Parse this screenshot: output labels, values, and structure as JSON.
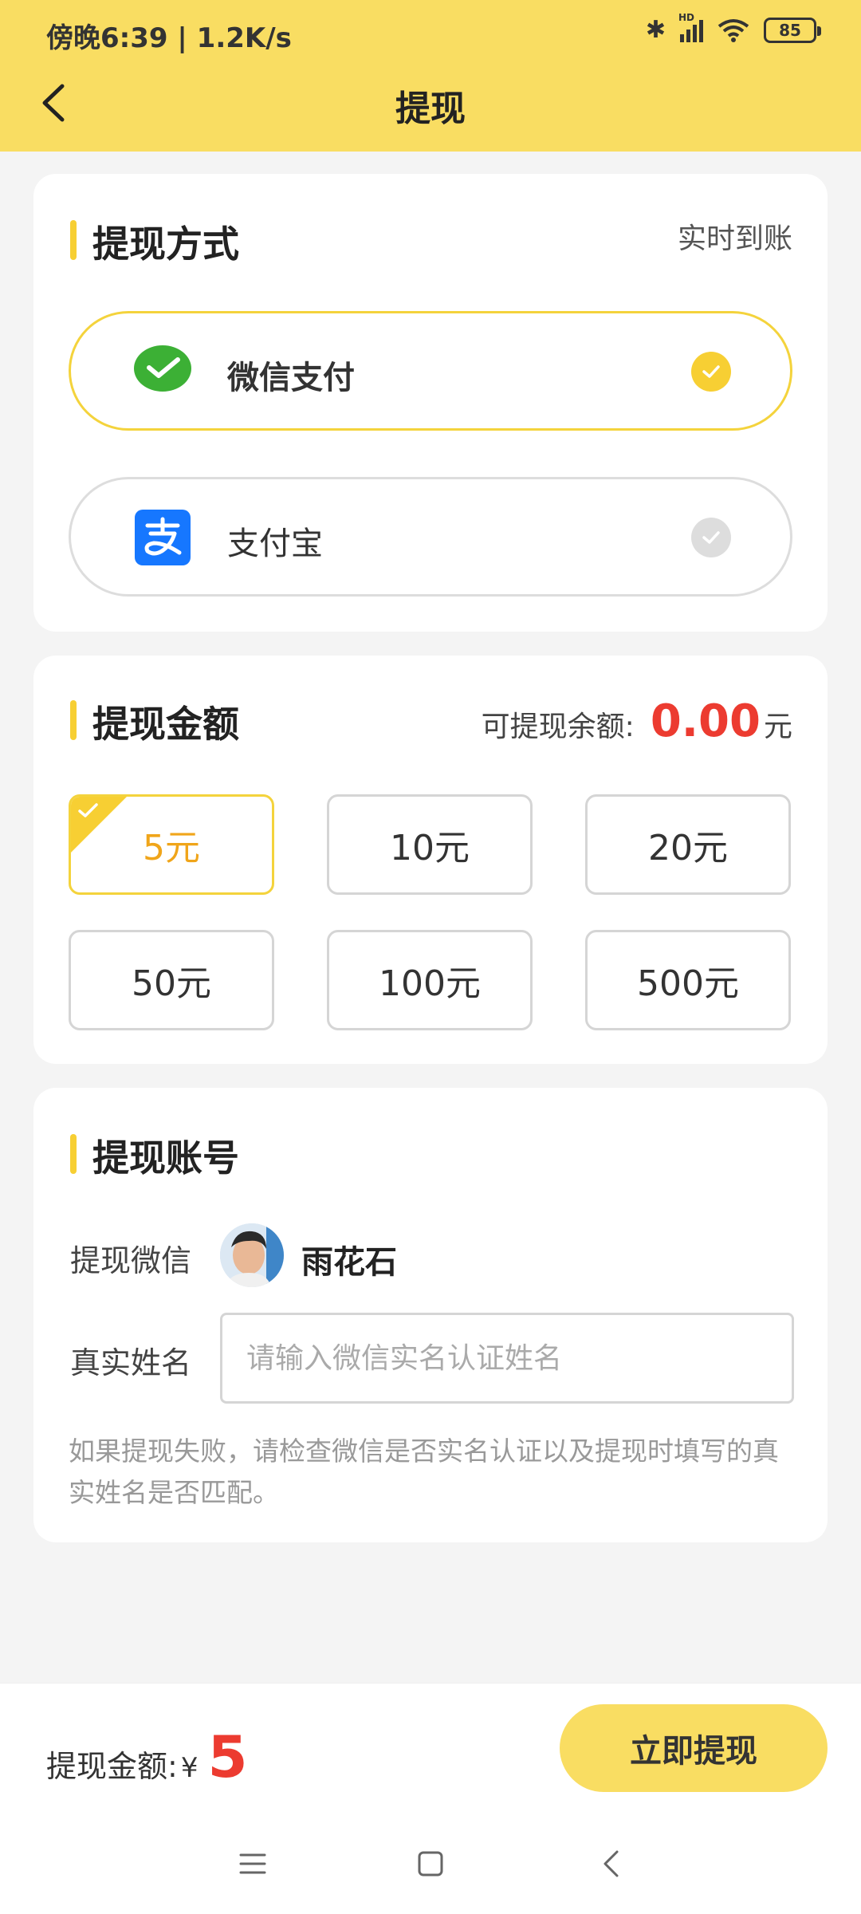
{
  "status_bar": {
    "time": "傍晚6:39 | 1.2K/s",
    "battery": "85",
    "network": "HD"
  },
  "header": {
    "title": "提现"
  },
  "method_section": {
    "title": "提现方式",
    "realtime_label": "实时到账",
    "options": [
      {
        "label": "微信支付",
        "icon": "wechat-icon",
        "selected": true
      },
      {
        "label": "支付宝",
        "icon": "alipay-icon",
        "selected": false
      }
    ]
  },
  "amount_section": {
    "title": "提现金额",
    "balance_label": "可提现余额:",
    "balance_value": "0.00",
    "balance_unit": "元",
    "options": [
      "5元",
      "10元",
      "20元",
      "50元",
      "100元",
      "500元"
    ],
    "selected_index": 0
  },
  "account_section": {
    "title": "提现账号",
    "wechat_label": "提现微信",
    "nickname": "雨花石",
    "realname_label": "真实姓名",
    "realname_placeholder": "请输入微信实名认证姓名",
    "realname_value": "",
    "note": "如果提现失败，请检查微信是否实名认证以及提现时填写的真实姓名是否匹配。"
  },
  "bottom_bar": {
    "total_label": "提现金额:",
    "currency": "¥",
    "total_value": "5",
    "submit_label": "立即提现"
  },
  "colors": {
    "accent": "#f9dd62",
    "highlight": "#f7cf33",
    "price": "#ec3b30",
    "wechat": "#3cb035",
    "alipay": "#1677ff"
  }
}
